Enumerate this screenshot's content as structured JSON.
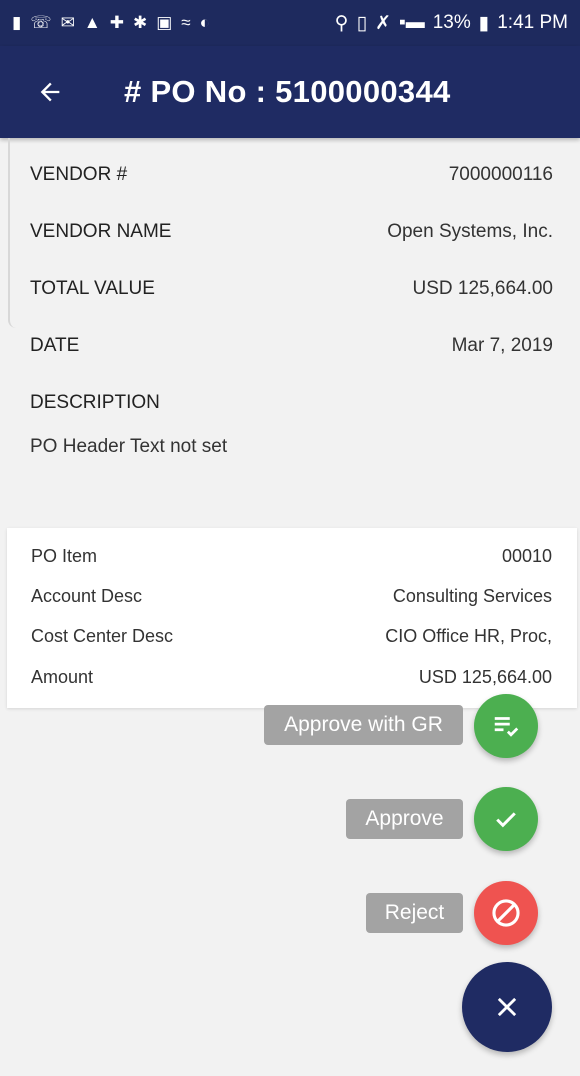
{
  "status_bar": {
    "battery": "13%",
    "time": "1:41 PM"
  },
  "app_bar": {
    "title": "# PO No : 5100000344",
    "back_icon": "arrow-left-icon"
  },
  "po_header": {
    "fields": [
      {
        "label": "VENDOR #",
        "value": "7000000116"
      },
      {
        "label": "VENDOR NAME",
        "value": "Open Systems, Inc."
      },
      {
        "label": "TOTAL VALUE",
        "value": "USD 125,664.00"
      },
      {
        "label": "DATE",
        "value": "Mar 7, 2019"
      }
    ],
    "description_label": "DESCRIPTION",
    "description_text": "PO Header Text not set"
  },
  "po_item": {
    "rows": [
      {
        "label": "PO Item",
        "value": "00010"
      },
      {
        "label": "Account Desc",
        "value": "Consulting Services"
      },
      {
        "label": "Cost Center Desc",
        "value": "CIO Office HR, Proc,"
      },
      {
        "label": "Amount",
        "value": "USD 125,664.00"
      }
    ]
  },
  "actions": {
    "approve_gr_label": "Approve with GR",
    "approve_label": "Approve",
    "reject_label": "Reject"
  },
  "colors": {
    "app_bar": "#1f2b63",
    "approve": "#4caf50",
    "reject": "#ef5350",
    "fab_main": "#1f2b63",
    "fab_label": "#a3a3a3"
  }
}
